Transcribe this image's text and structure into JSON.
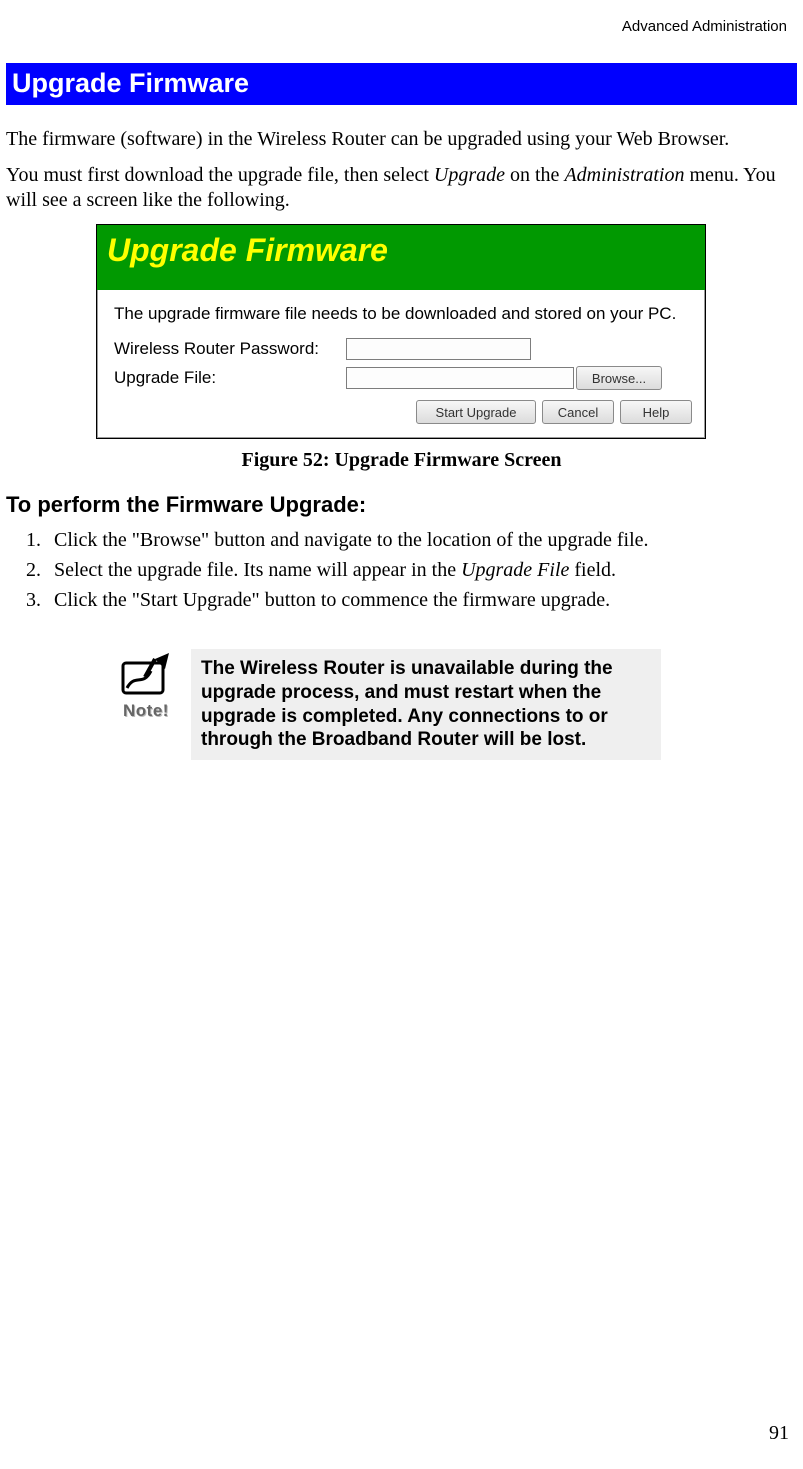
{
  "header": {
    "running": "Advanced Administration"
  },
  "section": {
    "title": "Upgrade Firmware"
  },
  "intro": {
    "p1": "The firmware (software) in the Wireless Router can be upgraded using your Web Browser.",
    "p2a": "You must first download the upgrade file, then select ",
    "p2b": "Upgrade",
    "p2c": " on the ",
    "p2d": "Administration",
    "p2e": " menu. You will see a screen like the following."
  },
  "figure": {
    "window_title": "Upgrade Firmware",
    "msg": "The upgrade firmware file needs to be downloaded and stored on your PC.",
    "label_password": "Wireless Router Password:",
    "label_file": "Upgrade File:",
    "btn_browse": "Browse...",
    "btn_start": "Start Upgrade",
    "btn_cancel": "Cancel",
    "btn_help": "Help",
    "caption": "Figure 52: Upgrade Firmware Screen"
  },
  "steps": {
    "heading": "To perform the Firmware Upgrade:",
    "s1": "Click the \"Browse\" button and navigate to the location of the upgrade file.",
    "s2a": "Select the upgrade file. Its name will appear in the ",
    "s2b": "Upgrade File",
    "s2c": " field.",
    "s3": "Click the \"Start Upgrade\" button to commence the firmware upgrade."
  },
  "note": {
    "label": "Note!",
    "text": "The Wireless Router is unavailable during the upgrade process, and must restart when the upgrade is completed. Any connections to or through the Broadband Router will be lost."
  },
  "page_number": "91"
}
